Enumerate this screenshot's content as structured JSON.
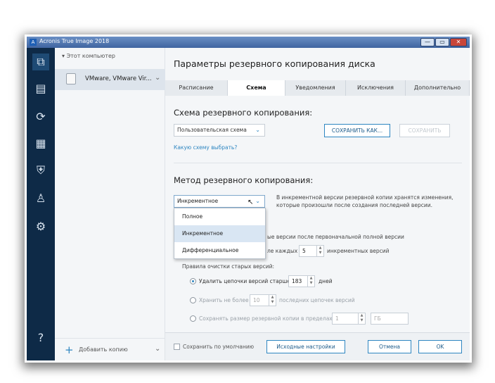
{
  "window": {
    "title": "Acronis True Image 2018",
    "app_icon": "A",
    "min": "—",
    "max": "▭",
    "close": "✕"
  },
  "rail": {
    "icons": [
      "backup-icon",
      "archive-icon",
      "sync-icon",
      "dashboard-icon",
      "protection-icon",
      "account-icon",
      "settings-icon",
      "help-icon"
    ]
  },
  "sidebar": {
    "header": "Этот компьютер",
    "item_label": "VMware, VMware Vir...",
    "add_label": "Добавить копию"
  },
  "main": {
    "title": "Параметры резервного копирования диска",
    "tabs": [
      "Расписание",
      "Схема",
      "Уведомления",
      "Исключения",
      "Дополнительно"
    ],
    "active_tab": "Схема"
  },
  "scheme": {
    "heading": "Схема резервного копирования:",
    "select_value": "Пользовательская схема",
    "save_as": "СОХРАНИТЬ КАК...",
    "save": "СОХРАНИТЬ",
    "help_link": "Какую схему выбрать?"
  },
  "method": {
    "heading": "Метод резервного копирования:",
    "select_value": "Инкрементное",
    "description": "В инкрементной версии резервной копии хранятся изменения, которые произошли после создания последней версии.",
    "options": [
      "Полное",
      "Инкрементное",
      "Дифференциальное"
    ],
    "highlighted_option": "Инкрементное",
    "line_full_version": "ые версии после первоначальной полной версии",
    "line_every_prefix": "ле каждых",
    "every_value": "5",
    "line_every_suffix": "инкрементных версий"
  },
  "cleanup": {
    "heading": "Правила очистки старых версий:",
    "opt1_label": "Удалить цепочки версий старше",
    "opt1_value": "183",
    "opt1_unit": "дней",
    "opt2_label": "Хранить не более",
    "opt2_value": "10",
    "opt2_unit": "последних цепочек версий",
    "opt3_label": "Сохранять размер резервной копии в пределах",
    "opt3_value": "1",
    "opt3_unit": "ГБ"
  },
  "footer": {
    "default_checkbox": "Сохранить по умолчанию",
    "source_settings": "Исходные настройки",
    "cancel": "Отмена",
    "ok": "OK"
  }
}
